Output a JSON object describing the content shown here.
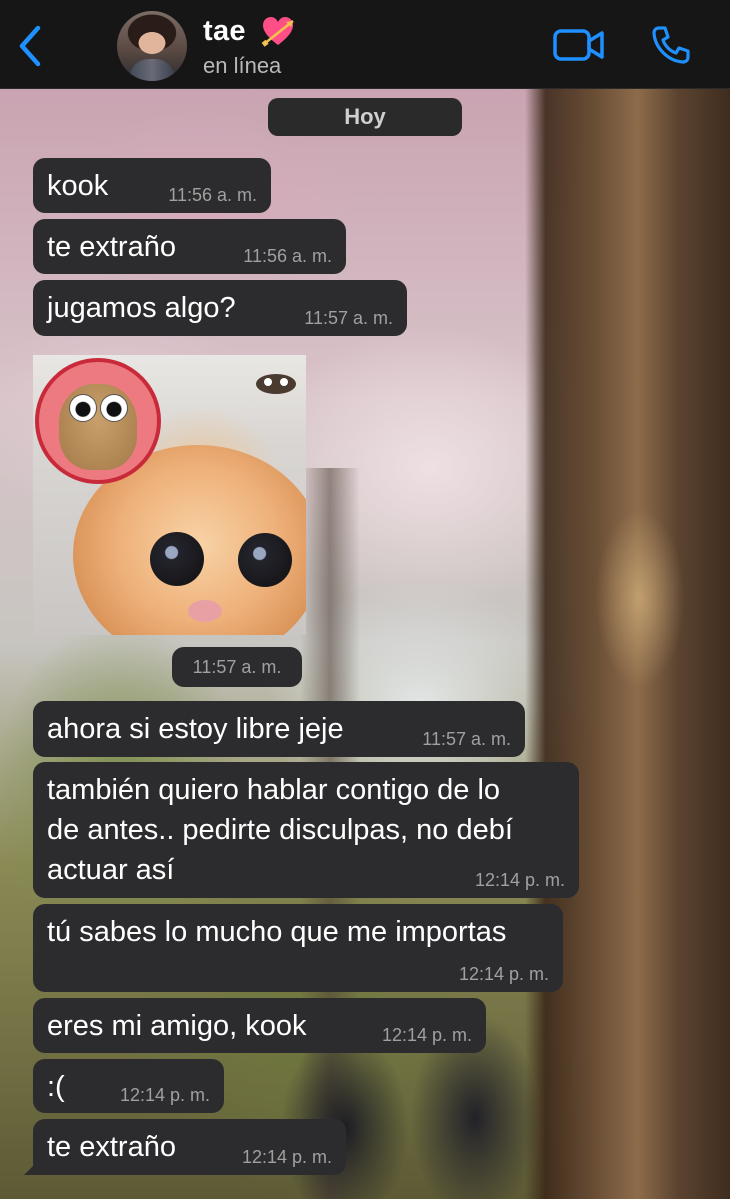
{
  "header": {
    "contact_name": "tae",
    "contact_status": "en línea",
    "back_icon": "chevron-left-icon",
    "video_icon": "video-camera-icon",
    "call_icon": "phone-icon",
    "heart_icon": "heart-with-arrow-icon",
    "accent_color": "#1e90ff"
  },
  "date_separator": "Hoy",
  "messages": [
    {
      "text": "kook",
      "time": "11:56 a. m."
    },
    {
      "text": "te extraño",
      "time": "11:56 a. m."
    },
    {
      "text": "jugamos algo?",
      "time": "11:57 a. m."
    },
    {
      "image_time": "11:57 a. m."
    },
    {
      "text": "ahora si estoy libre jeje",
      "time": "11:57 a. m."
    },
    {
      "text": "también quiero hablar contigo de lo\nde antes.. pedirte disculpas, no debí\nactuar así",
      "time": "12:14 p. m."
    },
    {
      "text": "tú sabes lo mucho que me importas",
      "time": "12:14 p. m."
    },
    {
      "text": "eres mi amigo, kook",
      "time": "12:14 p. m."
    },
    {
      "text": ":(",
      "time": "12:14 p. m."
    },
    {
      "text": "te extraño",
      "time": "12:14 p. m."
    }
  ],
  "colors": {
    "header_bg": "#161616",
    "bubble_bg": "#2c2c2e",
    "time_text": "#a0a0a0"
  }
}
